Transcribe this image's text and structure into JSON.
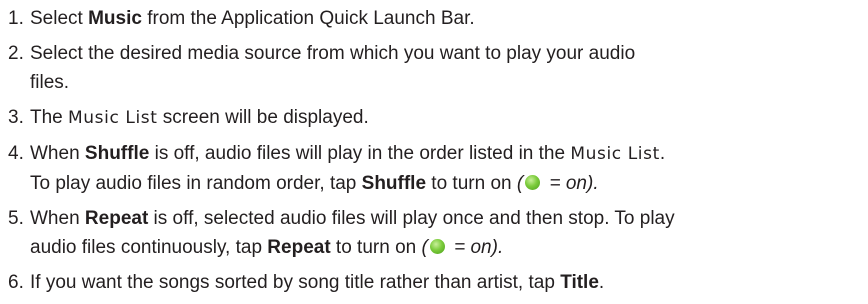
{
  "steps": [
    {
      "number": "1.",
      "lines": [
        {
          "t1": "Select ",
          "b1": "Music",
          "t2": " from the Application Quick Launch Bar."
        }
      ]
    },
    {
      "number": "2.",
      "lines": [
        {
          "t1": "Select the desired media source from which you want to play your audio"
        },
        {
          "t1": "files."
        }
      ]
    },
    {
      "number": "3.",
      "lines": [
        {
          "t1": "The ",
          "m1": "Music List",
          "t2": " screen will be displayed."
        }
      ]
    },
    {
      "number": "4.",
      "lines": [
        {
          "t1": "When ",
          "b1": "Shuffle",
          "t2": " is off, audio files will play in the order listed in the ",
          "m1": "Music List",
          "t3": "."
        },
        {
          "t1": "To play audio files in random order, tap ",
          "b1": "Shuffle",
          "t2": " to turn on ",
          "i1": "(",
          "i2": " = on)."
        }
      ]
    },
    {
      "number": "5.",
      "lines": [
        {
          "t1": "When ",
          "b1": "Repeat",
          "t2": " is off, selected audio files will play once and then stop. To play"
        },
        {
          "t1": "audio files continuously, tap ",
          "b1": "Repeat",
          "t2": " to turn on ",
          "i1": "(",
          "i2": " = on)."
        }
      ]
    },
    {
      "number": "6.",
      "lines": [
        {
          "t1": "If you want the songs sorted by song title rather than artist, tap ",
          "b1": "Title",
          "t2": "."
        }
      ]
    }
  ],
  "icons": {
    "on_indicator": "green-dot-icon"
  },
  "colors": {
    "text": "#231f20",
    "on_indicator": "#7ccc3c"
  }
}
